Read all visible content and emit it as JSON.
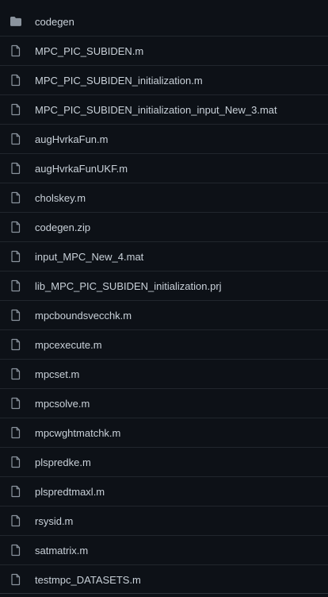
{
  "colors": {
    "background": "#0d1117",
    "text": "#c9d1d9",
    "icon": "#8b949e",
    "divider": "#21262d"
  },
  "files": [
    {
      "name": "codegen",
      "type": "folder",
      "icon": "folder-icon"
    },
    {
      "name": "MPC_PIC_SUBIDEN.m",
      "type": "file",
      "icon": "file-icon"
    },
    {
      "name": "MPC_PIC_SUBIDEN_initialization.m",
      "type": "file",
      "icon": "file-icon"
    },
    {
      "name": "MPC_PIC_SUBIDEN_initialization_input_New_3.mat",
      "type": "file",
      "icon": "file-icon"
    },
    {
      "name": "augHvrkaFun.m",
      "type": "file",
      "icon": "file-icon"
    },
    {
      "name": "augHvrkaFunUKF.m",
      "type": "file",
      "icon": "file-icon"
    },
    {
      "name": "cholskey.m",
      "type": "file",
      "icon": "file-icon"
    },
    {
      "name": "codegen.zip",
      "type": "file",
      "icon": "file-icon"
    },
    {
      "name": "input_MPC_New_4.mat",
      "type": "file",
      "icon": "file-icon"
    },
    {
      "name": "lib_MPC_PIC_SUBIDEN_initialization.prj",
      "type": "file",
      "icon": "file-icon"
    },
    {
      "name": "mpcboundsvecchk.m",
      "type": "file",
      "icon": "file-icon"
    },
    {
      "name": "mpcexecute.m",
      "type": "file",
      "icon": "file-icon"
    },
    {
      "name": "mpcset.m",
      "type": "file",
      "icon": "file-icon"
    },
    {
      "name": "mpcsolve.m",
      "type": "file",
      "icon": "file-icon"
    },
    {
      "name": "mpcwghtmatchk.m",
      "type": "file",
      "icon": "file-icon"
    },
    {
      "name": "plspredke.m",
      "type": "file",
      "icon": "file-icon"
    },
    {
      "name": "plspredtmaxl.m",
      "type": "file",
      "icon": "file-icon"
    },
    {
      "name": "rsysid.m",
      "type": "file",
      "icon": "file-icon"
    },
    {
      "name": "satmatrix.m",
      "type": "file",
      "icon": "file-icon"
    },
    {
      "name": "testmpc_DATASETS.m",
      "type": "file",
      "icon": "file-icon"
    }
  ]
}
